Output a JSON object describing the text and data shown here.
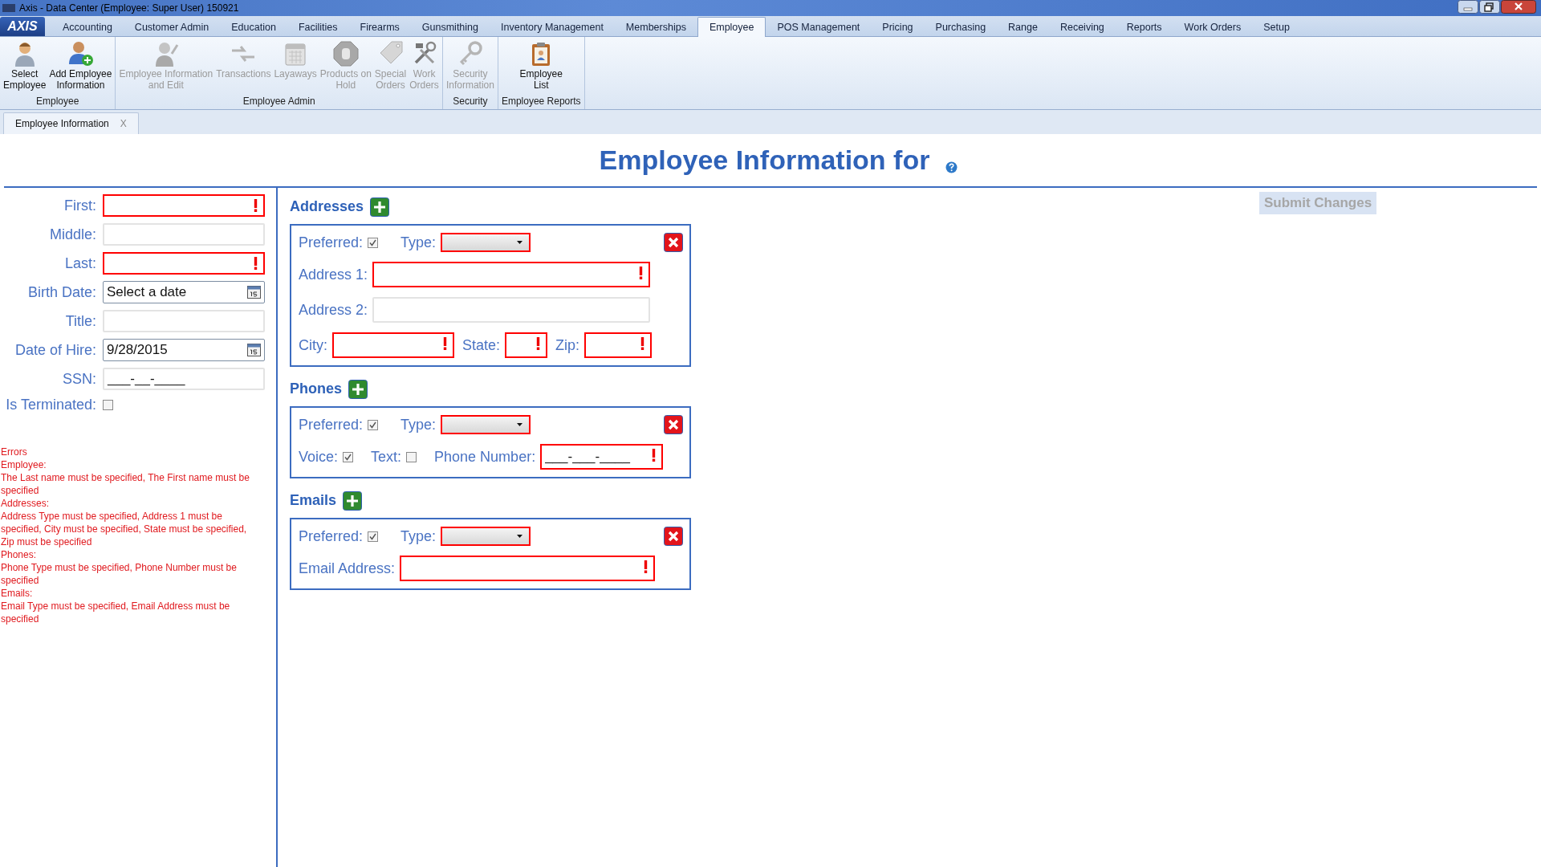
{
  "window": {
    "title": "Axis - Data Center  (Employee: Super User) 150921"
  },
  "logo": "AXIS",
  "menu_tabs": [
    {
      "label": "Accounting",
      "selected": false
    },
    {
      "label": "Customer Admin",
      "selected": false
    },
    {
      "label": "Education",
      "selected": false
    },
    {
      "label": "Facilities",
      "selected": false
    },
    {
      "label": "Firearms",
      "selected": false
    },
    {
      "label": "Gunsmithing",
      "selected": false
    },
    {
      "label": "Inventory Management",
      "selected": false
    },
    {
      "label": "Memberships",
      "selected": false
    },
    {
      "label": "Employee",
      "selected": true
    },
    {
      "label": "POS Management",
      "selected": false
    },
    {
      "label": "Pricing",
      "selected": false
    },
    {
      "label": "Purchasing",
      "selected": false
    },
    {
      "label": "Range",
      "selected": false
    },
    {
      "label": "Receiving",
      "selected": false
    },
    {
      "label": "Reports",
      "selected": false
    },
    {
      "label": "Work Orders",
      "selected": false
    },
    {
      "label": "Setup",
      "selected": false
    }
  ],
  "ribbon_groups": [
    {
      "label": "Employee",
      "buttons": [
        {
          "label": "Select\nEmployee",
          "disabled": false
        },
        {
          "label": "Add Employee\nInformation",
          "disabled": false
        }
      ]
    },
    {
      "label": "Employee Admin",
      "buttons": [
        {
          "label": "Employee Information\nand Edit",
          "disabled": true
        },
        {
          "label": "Transactions",
          "disabled": true
        },
        {
          "label": "Layaways",
          "disabled": true
        },
        {
          "label": "Products on\nHold",
          "disabled": true
        },
        {
          "label": "Special\nOrders",
          "disabled": true
        },
        {
          "label": "Work\nOrders",
          "disabled": true
        }
      ]
    },
    {
      "label": "Security",
      "buttons": [
        {
          "label": "Security\nInformation",
          "disabled": true
        }
      ]
    },
    {
      "label": "Employee Reports",
      "buttons": [
        {
          "label": "Employee\nList",
          "disabled": false
        }
      ]
    }
  ],
  "document_tabs": [
    {
      "label": "Employee Information",
      "close": "X"
    }
  ],
  "heading": "Employee Information for",
  "submit_button": {
    "label": "Submit Changes",
    "disabled": true
  },
  "employee_fields": [
    {
      "label": "First:",
      "kind": "text",
      "invalid": true
    },
    {
      "label": "Middle:",
      "kind": "text",
      "invalid": false
    },
    {
      "label": "Last:",
      "kind": "text",
      "invalid": true
    },
    {
      "label": "Birth Date:",
      "kind": "date",
      "placeholder": "Select a date",
      "invalid": false
    },
    {
      "label": "Title:",
      "kind": "text",
      "invalid": false
    },
    {
      "label": "Date of Hire:",
      "kind": "date",
      "value": "9/28/2015",
      "invalid": false
    },
    {
      "label": "SSN:",
      "kind": "text",
      "value": "___-__-____",
      "invalid": false
    },
    {
      "label": "Is Terminated:",
      "kind": "checkbox",
      "checked": false
    }
  ],
  "errors": [
    "Errors",
    "Employee:",
    "The Last name must be specified, The First name must be specified",
    "Addresses:",
    "Address Type must be specified, Address 1 must be specified, City must be specified, State must be specified, Zip must be specified",
    "Phones:",
    "Phone Type must be specified, Phone Number must be specified",
    "Emails:",
    "Email Type must be specified, Email Address must be specified"
  ],
  "sections": [
    {
      "kind": "address",
      "heading": "Addresses",
      "entries": [
        {
          "preferred": {
            "label": "Preferred:",
            "checked": true
          },
          "type": {
            "label": "Type:",
            "invalid": true
          },
          "address_1": {
            "label": "Address 1:",
            "invalid": true
          },
          "address_2": {
            "label": "Address 2:",
            "invalid": false
          },
          "city": {
            "label": "City:",
            "invalid": true
          },
          "state": {
            "label": "State:",
            "invalid": true
          },
          "zip": {
            "label": "Zip:",
            "invalid": true
          }
        }
      ]
    },
    {
      "kind": "phone",
      "heading": "Phones",
      "entries": [
        {
          "preferred": {
            "label": "Preferred:",
            "checked": true
          },
          "type": {
            "label": "Type:",
            "invalid": true
          },
          "voice": {
            "label": "Voice:",
            "checked": true
          },
          "text": {
            "label": "Text:",
            "checked": false
          },
          "phone_number": {
            "label": "Phone Number:",
            "value": "___-___-____",
            "invalid": true
          }
        }
      ]
    },
    {
      "kind": "email",
      "heading": "Emails",
      "entries": [
        {
          "preferred": {
            "label": "Preferred:",
            "checked": true
          },
          "type": {
            "label": "Type:",
            "invalid": true
          },
          "email_address": {
            "label": "Email Address:",
            "invalid": true
          }
        }
      ]
    }
  ]
}
